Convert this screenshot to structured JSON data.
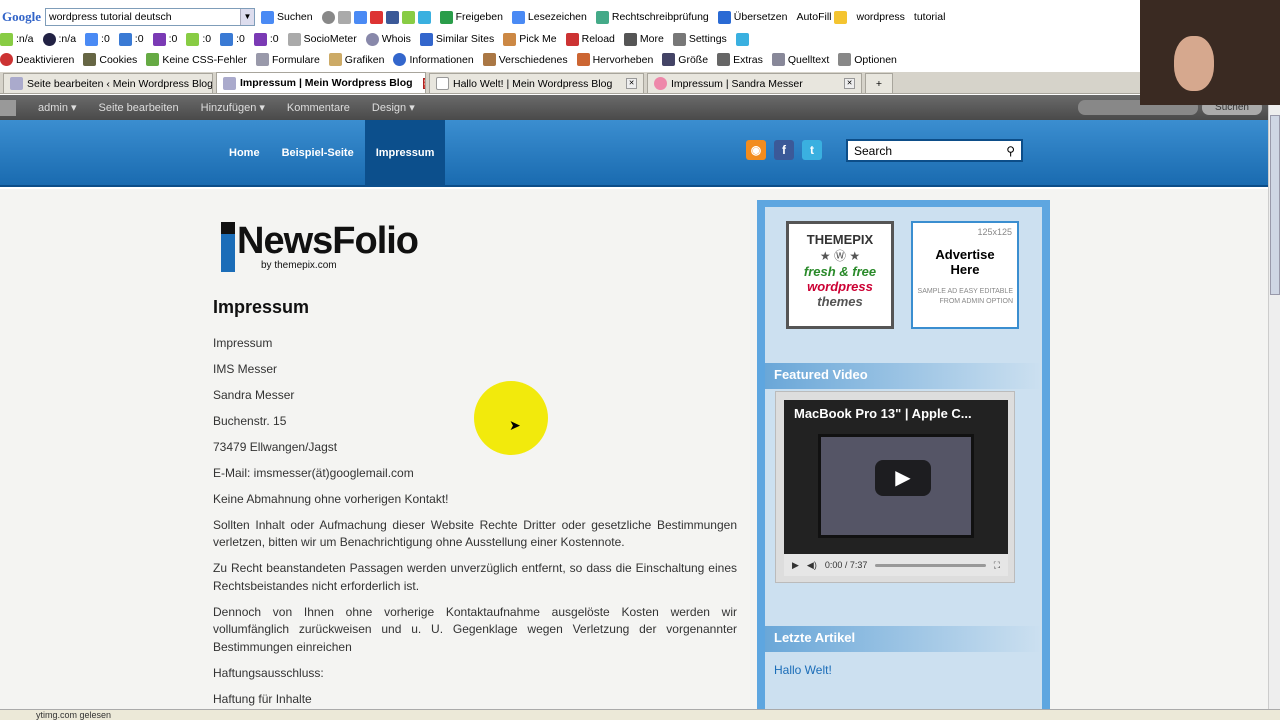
{
  "toolbar1": {
    "search_value": "wordpress tutorial deutsch",
    "items": [
      "Suchen",
      "Freigeben",
      "Lesezeichen",
      "Rechtschreibprüfung",
      "Übersetzen",
      "AutoFill",
      "wordpress",
      "tutorial"
    ]
  },
  "toolbar2": {
    "items": [
      ":n/a",
      ":n/a",
      ":0",
      ":0",
      ":0",
      ":0",
      ":0",
      ":0",
      "SocioMeter",
      "Whois",
      "Similar Sites",
      "Pick Me",
      "Reload",
      "More",
      "Settings"
    ]
  },
  "toolbar3": {
    "items": [
      "Deaktivieren",
      "Cookies",
      "Keine CSS-Fehler",
      "Formulare",
      "Grafiken",
      "Informationen",
      "Verschiedenes",
      "Hervorheben",
      "Größe",
      "Extras",
      "Quelltext",
      "Optionen"
    ]
  },
  "tabs": [
    "Seite bearbeiten ‹ Mein Wordpress Blog ...",
    "Impressum | Mein Wordpress Blog",
    "Hallo Welt! | Mein Wordpress Blog",
    "Impressum | Sandra Messer"
  ],
  "adminbar": {
    "items": [
      "admin ▾",
      "Seite bearbeiten",
      "Hinzufügen ▾",
      "Kommentare",
      "Design ▾"
    ],
    "search_button": "Suchen"
  },
  "nav": [
    "Home",
    "Beispiel-Seite",
    "Impressum"
  ],
  "search_placeholder": "Search",
  "logo": {
    "name": "NewsFolio",
    "by": "by themepix.com"
  },
  "article": {
    "title": "Impressum",
    "paragraphs": [
      "Impressum",
      "IMS Messer",
      "Sandra Messer",
      "Buchenstr. 15",
      "73479 Ellwangen/Jagst",
      "E-Mail: imsmesser(ät)googlemail.com",
      "Keine Abmahnung ohne vorherigen Kontakt!",
      "Sollten Inhalt oder Aufmachung dieser Website Rechte Dritter oder gesetzliche Bestimmungen verletzen, bitten wir um Benachrichtigung ohne Ausstellung einer Kostennote.",
      "Zu Recht beanstandeten Passagen werden unverzüglich entfernt, so dass die Einschaltung eines Rechtsbeistandes nicht erforderlich ist.",
      "Dennoch von Ihnen ohne vorherige Kontaktaufnahme ausgelöste Kosten werden wir vollumfänglich zurückweisen und u. U. Gegenklage wegen Verletzung der vorgenannter Bestimmungen einreichen",
      "Haftungsausschluss:",
      "Haftung für Inhalte"
    ]
  },
  "sidebar": {
    "ad1": {
      "brand": "THEMEPIX",
      "line1": "fresh & free",
      "line2": "wordpress",
      "line3": "themes"
    },
    "ad2": {
      "size": "125x125",
      "title": "Advertise Here",
      "note": "SAMPLE AD EASY EDITABLE FROM ADMIN OPTION"
    },
    "featured_title": "Featured Video",
    "video_title": "MacBook Pro 13\" | Apple C...",
    "video_time": "0:00 / 7:37",
    "recent_title": "Letzte Artikel",
    "recent_items": [
      "Hallo Welt!"
    ]
  },
  "status": "ytimg.com gelesen",
  "colors": {
    "header": "#1a6bb0",
    "sidebar": "#5ea6e0",
    "highlight": "#f2ea0c"
  }
}
